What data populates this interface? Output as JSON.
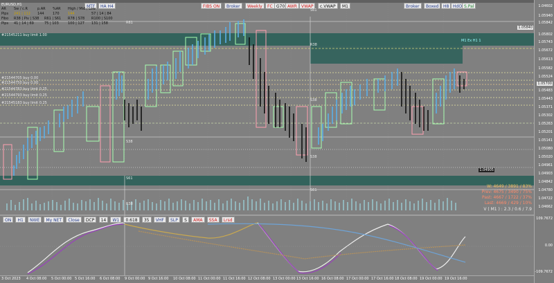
{
  "symbol_title": "EURUSD,H1",
  "top_buttons_left": [
    "MTF",
    "HA H4"
  ],
  "top_buttons_center": [
    "FIBS ON",
    "Broker",
    "Weekly",
    "FC",
    "G70",
    "AWR",
    "VWAP",
    "c.VWAP",
    "M1"
  ],
  "top_buttons_right": [
    "Broker",
    "Boxed",
    "H8",
    "HdO",
    "S.Pal"
  ],
  "info_panel": {
    "row1": [
      "AR",
      "Sw / c.R",
      "p.AR",
      "%AR",
      "High / Mid / Low"
    ],
    "row2": [
      "Pips",
      "241 | 112",
      "144",
      "170",
      "144",
      "57 | 14 | 84"
    ],
    "row3": [
      "Fibo",
      "R38 | Piv | S38",
      "R61 | S61",
      "R78 | S78",
      "R100 | S100"
    ],
    "row4": [
      "Pips",
      "41 | 14 | 69",
      "75 | 103",
      "100 | 127",
      "131 | 158"
    ]
  },
  "order_labels": [
    "#21544705 buy 0.00",
    "#21544750 buy 0.00",
    "#21544783 buy limit 0.25",
    "#21544793 buy limit 0.25",
    "#21545183 buy limit 0.25",
    "#21545211 buy limit 1.00"
  ],
  "level_labels": [
    "S61",
    "R38",
    "S38",
    "S61",
    "R61",
    "S38",
    "S61",
    "R38",
    "S38"
  ],
  "price_axis": [
    "1.05940",
    "1.05842",
    "1.05802",
    "1.05743",
    "1.05672",
    "1.05613",
    "1.05582",
    "1.05524",
    "1.05483",
    "1.05443",
    "1.05371",
    "1.05302",
    "1.05263",
    "1.05201",
    "1.05141",
    "1.05080",
    "1.05020",
    "1.04961",
    "1.04903",
    "1.04842",
    "1.04780",
    "1.04722",
    "1.04662",
    "1.04602"
  ],
  "price_box_top": "1.05840",
  "price_box_mid": "1.05700",
  "price_box_low": "1.04905",
  "right_note": "M1  Ex H1 1",
  "stats": {
    "line1": "W: 4649 / 3891 / 83%",
    "line2": "Prev: 4675 / 3490 / 75%",
    "line3": "Past: 4667 / 1722 / 37%",
    "line4": "Last: 4669 / 429 / 10%",
    "line5": "V ( M1 ) : 2.3 / 0.6 / 7.9"
  },
  "indicator_buttons": [
    "ON",
    "H1",
    "NWE",
    "My NET",
    "Close",
    "DCP",
    "14",
    "W1",
    "0.618",
    "35",
    "VHF",
    "SLP",
    "S",
    "AMA",
    "SSA",
    "Lrsd"
  ],
  "indicator_axis": [
    "109.7672",
    "0.00",
    "-109.7672"
  ],
  "time_axis": [
    "3 Oct 2023",
    "4 Oct 08:00",
    "5 Oct 00:00",
    "5 Oct 16:00",
    "6 Oct 08:00",
    "9 Oct 00:00",
    "9 Oct 16:00",
    "10 Oct 08:00",
    "11 Oct 00:00",
    "11 Oct 16:00",
    "12 Oct 08:00",
    "13 Oct 00:00",
    "13 Oct 16:00",
    "16 Oct 08:00",
    "17 Oct 00:00",
    "17 Oct 16:00",
    "18 Oct 08:00",
    "19 Oct 00:00",
    "19 Oct 16:00"
  ]
}
